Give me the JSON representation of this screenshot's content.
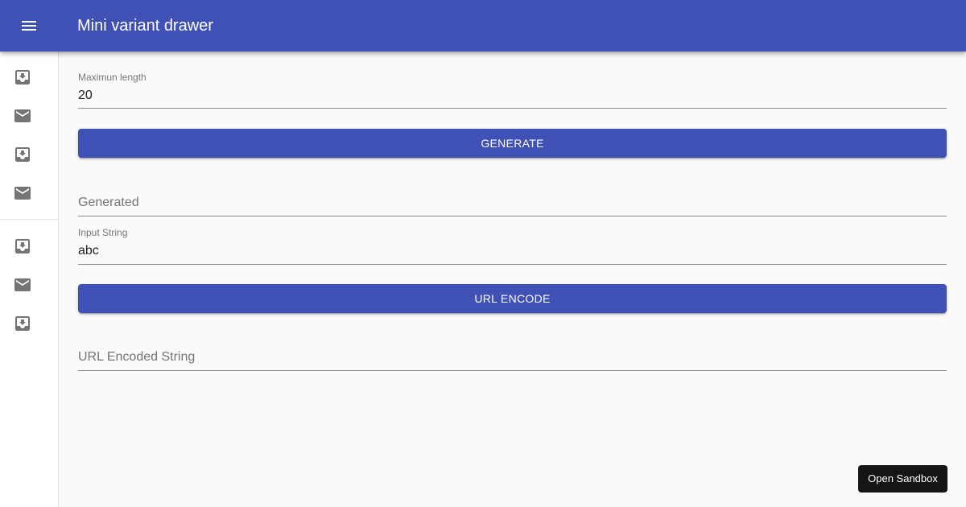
{
  "appbar": {
    "title": "Mini variant drawer",
    "background": "#3f51b5",
    "menu_icon": "menu-icon"
  },
  "drawer": {
    "items": [
      {
        "icon": "inbox-icon"
      },
      {
        "icon": "mail-icon"
      },
      {
        "icon": "inbox-icon"
      },
      {
        "icon": "mail-icon"
      },
      {
        "icon": "inbox-icon"
      },
      {
        "icon": "mail-icon"
      },
      {
        "icon": "inbox-icon"
      }
    ]
  },
  "form": {
    "max_length": {
      "label": "Maximun length",
      "value": "20"
    },
    "generate_button": "GENERATE",
    "generated": {
      "placeholder": "Generated",
      "value": ""
    },
    "input_string": {
      "label": "Input String",
      "value": "abc"
    },
    "url_encode_button": "URL ENCODE",
    "url_encoded": {
      "placeholder": "URL Encoded String",
      "value": ""
    }
  },
  "sandbox_button": "Open Sandbox",
  "colors": {
    "primary": "#3f51b5",
    "background": "#fafafa",
    "icon": "#757575",
    "sandbox_button": "#151515"
  }
}
